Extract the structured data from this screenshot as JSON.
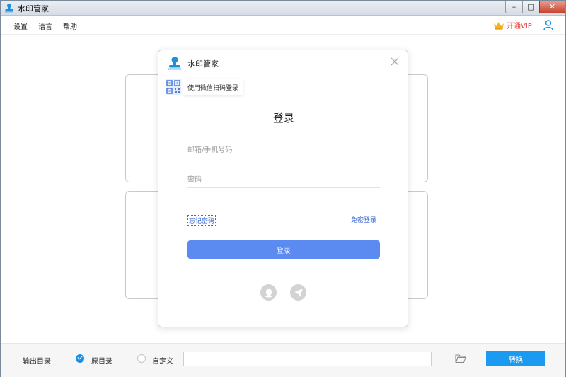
{
  "window": {
    "title": "水印管家",
    "controls": {
      "minimize": "–",
      "maximize": "□",
      "close": "✕"
    }
  },
  "menu": {
    "items": [
      "设置",
      "语言",
      "帮助"
    ],
    "vip_label": "开通VIP"
  },
  "colors": {
    "accent": "#1a9af0",
    "login_button": "#5b8af0",
    "vip": "#e8392e",
    "link": "#3a68d8"
  },
  "bottom": {
    "output_label": "输出目录",
    "option_original": "原目录",
    "option_custom": "自定义",
    "path_value": "",
    "convert_label": "转换"
  },
  "login": {
    "brand": "水印管家",
    "qr_tip": "使用微信扫码登录",
    "heading": "登录",
    "email_placeholder": "邮箱/手机号码",
    "password_placeholder": "密码",
    "remember_label": "忘记密码",
    "auto_login_label": "免密登录",
    "login_button": "登录",
    "social_icons": [
      "qq-icon",
      "paper-plane-icon"
    ]
  }
}
